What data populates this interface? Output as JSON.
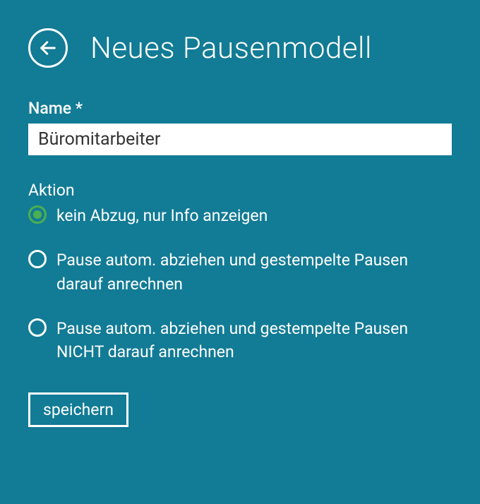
{
  "header": {
    "title": "Neues Pausenmodell"
  },
  "form": {
    "name_label": "Name *",
    "name_value": "Büromitarbeiter",
    "action_label": "Aktion",
    "options": [
      {
        "label": "kein Abzug, nur Info anzeigen",
        "selected": true
      },
      {
        "label": "Pause autom. abziehen und gestempelte Pausen darauf anrechnen",
        "selected": false
      },
      {
        "label": "Pause autom. abziehen und gestempelte Pausen NICHT darauf anrechnen",
        "selected": false
      }
    ],
    "save_label": "speichern"
  }
}
